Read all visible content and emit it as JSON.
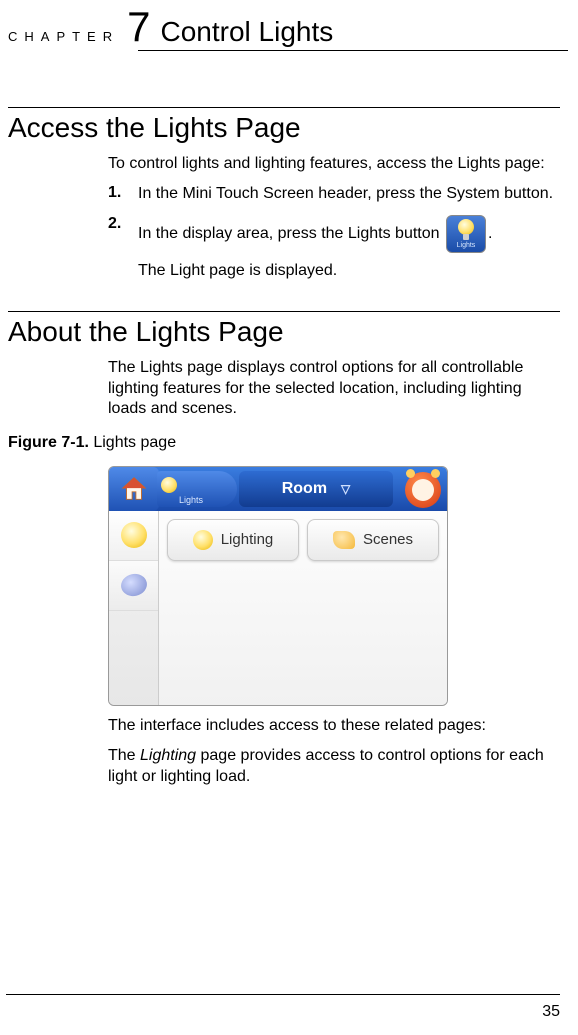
{
  "chapter": {
    "label": "CHAPTER",
    "number": "7",
    "title": "Control Lights"
  },
  "section1": {
    "heading": "Access the Lights Page",
    "intro": "To control lights and lighting features, access the Lights page:",
    "steps": {
      "s1_num": "1.",
      "s1_text": "In the Mini Touch Screen header, press the System button.",
      "s2_num": "2.",
      "s2_text_a": "In the display area, press the Lights button ",
      "s2_text_b": ".",
      "s2_result": "The Light page is displayed."
    },
    "lights_icon_label": "Lights"
  },
  "section2": {
    "heading": "About the Lights Page",
    "intro": "The Lights page displays control options for all controllable lighting features for the selected location, including lighting loads and scenes.",
    "figure_label_bold": "Figure 7-1.",
    "figure_label_rest": " Lights page",
    "after1": "The interface includes access to these related pages:",
    "after2_a": "The ",
    "after2_em": "Lighting",
    "after2_b": " page provides access to control options for each light or lighting load."
  },
  "screenshot": {
    "crumb_label": "Lights",
    "room_label": "Room",
    "tab_lighting": "Lighting",
    "tab_scenes": "Scenes"
  },
  "page_number": "35"
}
